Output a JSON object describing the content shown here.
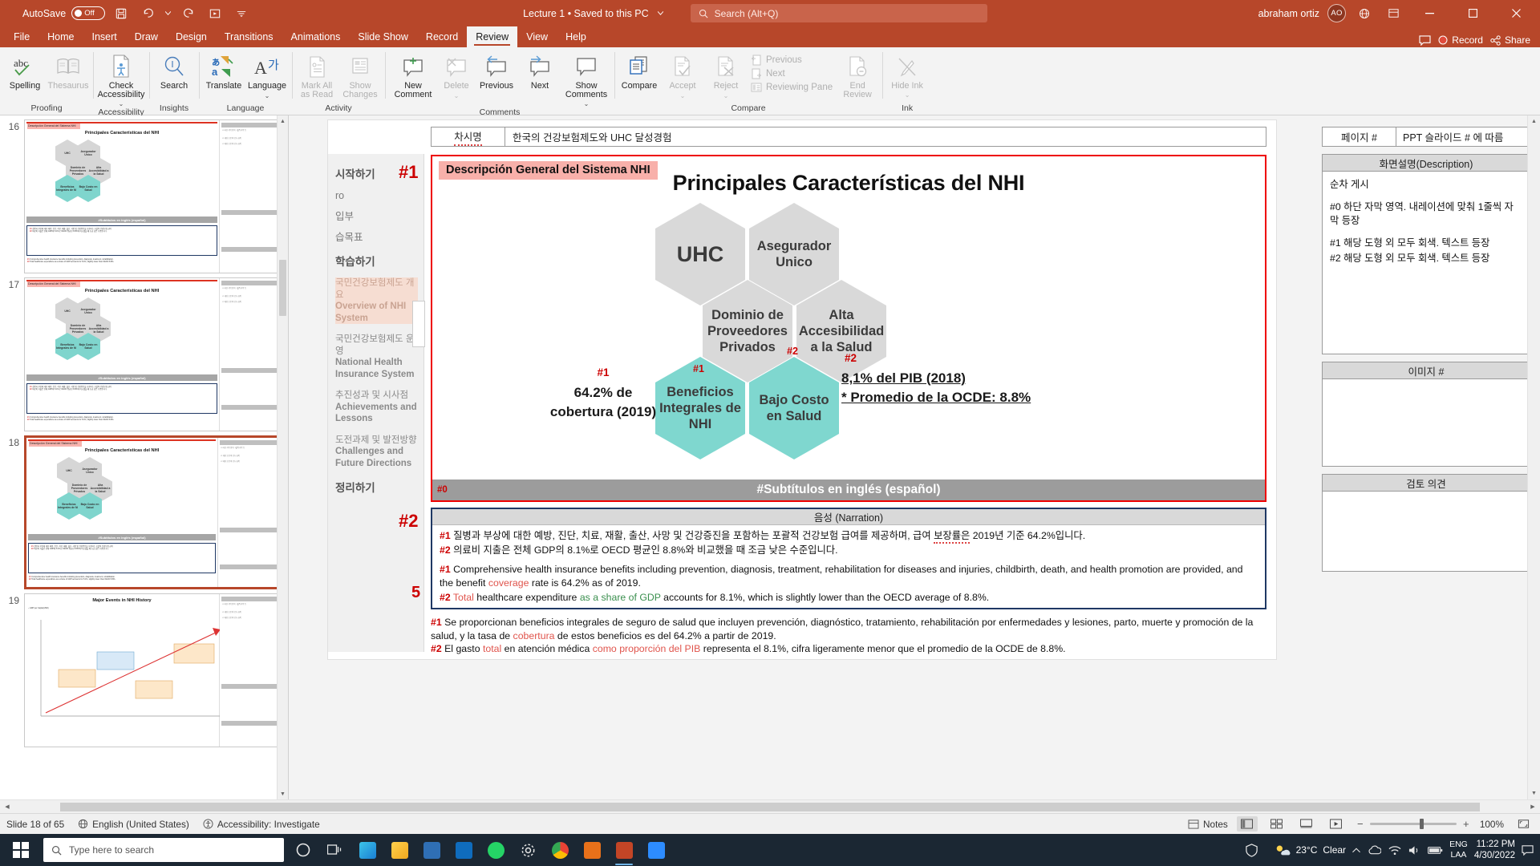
{
  "titlebar": {
    "autosave_label": "AutoSave",
    "autosave_state": "Off",
    "doc_title": "Lecture 1  •  Saved to this PC",
    "search_placeholder": "Search (Alt+Q)",
    "user_name": "abraham ortiz",
    "avatar_initials": "AO",
    "icons": [
      "save-icon",
      "undo-icon",
      "redo-icon",
      "present-icon",
      "customize-toolbar-icon"
    ]
  },
  "menubar": {
    "items": [
      "File",
      "Home",
      "Insert",
      "Draw",
      "Design",
      "Transitions",
      "Animations",
      "Slide Show",
      "Record",
      "Review",
      "View",
      "Help"
    ],
    "active": "Review",
    "record_label": "Record",
    "share_label": "Share",
    "comments_icon": "comment-icon"
  },
  "ribbon": {
    "groups": [
      {
        "name": "Proofing",
        "buttons": [
          {
            "label": "Spelling",
            "icon": "spelling-abc-icon",
            "disabled": false
          },
          {
            "label": "Thesaurus",
            "icon": "thesaurus-book-icon",
            "disabled": true
          }
        ]
      },
      {
        "name": "Accessibility",
        "buttons": [
          {
            "label": "Check Accessibility",
            "icon": "accessibility-person-icon",
            "disabled": false,
            "caret": "⌄"
          }
        ]
      },
      {
        "name": "Insights",
        "buttons": [
          {
            "label": "Search",
            "icon": "magnifier-icon",
            "disabled": false
          }
        ]
      },
      {
        "name": "Language",
        "buttons": [
          {
            "label": "Translate",
            "icon": "translate-icon",
            "disabled": false
          },
          {
            "label": "Language",
            "icon": "language-A-icon",
            "disabled": false,
            "caret": "⌄"
          }
        ]
      },
      {
        "name": "Activity",
        "buttons": [
          {
            "label": "Mark All as Read",
            "icon": "mark-read-icon",
            "disabled": true
          },
          {
            "label": "Show Changes",
            "icon": "show-changes-icon",
            "disabled": true
          }
        ]
      },
      {
        "name": "Comments",
        "buttons": [
          {
            "label": "New Comment",
            "icon": "new-comment-icon",
            "disabled": false
          },
          {
            "label": "Delete",
            "icon": "delete-comment-icon",
            "disabled": true,
            "caret": "⌄"
          },
          {
            "label": "Previous",
            "icon": "previous-comment-icon",
            "disabled": false
          },
          {
            "label": "Next",
            "icon": "next-comment-icon",
            "disabled": false
          },
          {
            "label": "Show Comments",
            "icon": "show-comments-icon",
            "disabled": false,
            "caret": "⌄"
          }
        ]
      },
      {
        "name": "Compare",
        "buttons": [
          {
            "label": "Compare",
            "icon": "compare-icon",
            "disabled": false
          },
          {
            "label": "Accept",
            "icon": "accept-icon",
            "disabled": true,
            "caret": "⌄"
          },
          {
            "label": "Reject",
            "icon": "reject-icon",
            "disabled": true,
            "caret": "⌄"
          }
        ],
        "small_items": [
          {
            "label": "Previous",
            "icon": "prev-change-icon"
          },
          {
            "label": "Next",
            "icon": "next-change-icon"
          },
          {
            "label": "Reviewing Pane",
            "icon": "reviewing-pane-icon"
          }
        ],
        "tail_button": {
          "label": "End Review",
          "icon": "end-review-icon",
          "disabled": true
        }
      },
      {
        "name": "Ink",
        "buttons": [
          {
            "label": "Hide Ink",
            "icon": "hide-ink-icon",
            "disabled": true,
            "caret": "⌄"
          }
        ]
      }
    ]
  },
  "thumbnails": [
    {
      "number": "16",
      "selected": false,
      "title": "Principales Características del NHI",
      "chip": "Descripción General del Sistema NHI",
      "subbar": "#Subtítulos en inglés (español)"
    },
    {
      "number": "17",
      "selected": false,
      "title": "Principales Características del NHI",
      "chip": "Descripción General del Sistema NHI",
      "subbar": "#Subtítulos en inglés (español)"
    },
    {
      "number": "18",
      "selected": true,
      "title": "Principales Características del NHI",
      "chip": "Descripción General del Sistema NHI",
      "subbar": "#Subtítulos en inglés (español)"
    },
    {
      "number": "19",
      "selected": false,
      "title": "Major Events in NHI History",
      "chip": "",
      "subbar": ""
    }
  ],
  "slide": {
    "nav": {
      "heading_start": "시작하기",
      "sub_intro": "ro",
      "sub_entry": "입부",
      "sub_goals": "습목표",
      "heading_learn": "학습하기",
      "items": [
        {
          "kr": "국민건강보험제도 개요",
          "en": "Overview of NHI System",
          "highlight": true
        },
        {
          "kr": "국민건강보험제도 운영",
          "en": "National Health Insurance System",
          "highlight": false
        },
        {
          "kr": "추진성과 및 시사점",
          "en": "Achievements and Lessons",
          "highlight": false
        },
        {
          "kr": "도전과제 및 발전방향",
          "en": "Challenges and Future Directions",
          "highlight": false
        }
      ],
      "heading_wrap": "정리하기"
    },
    "meta": {
      "key": "차시명",
      "value": "한국의 건강보험제도와 UHC 달성경험"
    },
    "marker_1": "#1",
    "marker_2": "#2",
    "marker_5": "5",
    "description_chip": "Descripción General del Sistema NHI",
    "title": "Principales Características del NHI",
    "hexes": [
      {
        "label": "UHC",
        "color": "gray",
        "tag": ""
      },
      {
        "label": "Asegurador Unico",
        "color": "gray",
        "tag": ""
      },
      {
        "label": "Dominio de Proveedores Privados",
        "color": "gray",
        "tag": ""
      },
      {
        "label": "Alta Accesibilidad a la Salud",
        "color": "gray",
        "tag": ""
      },
      {
        "label": "Beneficios Integrales de NHI",
        "color": "teal",
        "tag": "#1"
      },
      {
        "label": "Bajo Costo en Salud",
        "color": "teal",
        "tag": "#2"
      }
    ],
    "stat_left": {
      "tag": "#1",
      "line1": "64.2% de",
      "line2": "cobertura (2019)"
    },
    "stat_right": {
      "tag": "#2",
      "line1": "8,1% del PIB (2018)",
      "line2": "* Promedio de la OCDE: 8.8%"
    },
    "subbar": {
      "mark": "#0",
      "text": "#Subtítulos en inglés (español)"
    },
    "narration": {
      "header": "음성 (Narration)",
      "kr1_tag": "#1",
      "kr1_a": "질병과 부상에 대한 예방, 진단, 치료, 재활, 출산, 사망 및 건강증진을 포함하는 포괄적 건강보험 급여를 제공하며, 급여 ",
      "kr1_hl": "보장률은",
      "kr1_b": " 2019년 기준 64.2%입니다.",
      "kr2_tag": "#2",
      "kr2": "의료비 지출은 전체 GDP의 8.1%로 OECD 평균인 8.8%와 비교했을 때 조금 낮은 수준입니다.",
      "en1_tag": "#1",
      "en1_a": "Comprehensive health insurance benefits including prevention, diagnosis, treatment, rehabilitation for diseases and injuries, childbirth, death, and health promotion are provided, and the benefit ",
      "en1_hl": "coverage",
      "en1_b": " rate is 64.2% as of 2019.",
      "en2_tag": "#2",
      "en2_a": "Total",
      "en2_b": " healthcare expenditure ",
      "en2_hl": "as a share of GDP",
      "en2_c": " accounts for 8.1%, which is slightly lower than the OECD average of 8.8%."
    },
    "spanish": {
      "l1_tag": "#1",
      "l1_a": "Se proporcionan beneficios integrales de seguro de salud que incluyen prevención, diagnóstico, tratamiento, rehabilitación por enfermedades y lesiones, parto, muerte y promoción de la salud, y la tasa de ",
      "l1_hl": "cobertura",
      "l1_b": " de estos beneficios es del 64.2% a partir de 2019.",
      "l2_tag": "#2",
      "l2_a": "El gasto ",
      "l2_hl1": "total",
      "l2_b": " en atención médica ",
      "l2_hl2": "como proporción del PIB",
      "l2_c": " representa el 8.1%, cifra ligeramente menor que el promedio de la OCDE de 8.8%."
    }
  },
  "notespane": {
    "page_key": "페이지 #",
    "page_value": "PPT 슬라이드 # 에 따름",
    "desc_header": "화면설명(Description)",
    "desc_lines": [
      "순차 게시",
      "#0 하단 자막 영역. 내레이션에 맞춰 1줄씩 자막 등장",
      "#1 해당 도형 외 모두 회색. 텍스트 등장",
      "#2 해당 도형 외 모두 회색. 텍스트 등장"
    ],
    "image_header": "이미지 #",
    "review_header": "검토 의견"
  },
  "statusbar": {
    "slide_counter": "Slide 18 of 65",
    "language": "English (United States)",
    "accessibility": "Accessibility: Investigate",
    "notes_label": "Notes",
    "zoom_level": "100%",
    "view_buttons": [
      "normal-view-icon",
      "slide-sorter-icon",
      "reading-view-icon",
      "slideshow-icon"
    ],
    "fit_icon": "fit-slide-icon"
  },
  "taskbar": {
    "search_placeholder": "Type here to search",
    "temperature": "23°C",
    "weather": "Clear",
    "lang_line1": "ENG",
    "lang_line2": "LAA",
    "time": "11:22 PM",
    "date": "4/30/2022"
  },
  "colors": {
    "accent": "#b7472a",
    "teal": "#7fd7cf",
    "hex_gray": "#d9d9d9",
    "red": "#c00000",
    "navy": "#1f3864",
    "pink": "#f8b0aa"
  }
}
